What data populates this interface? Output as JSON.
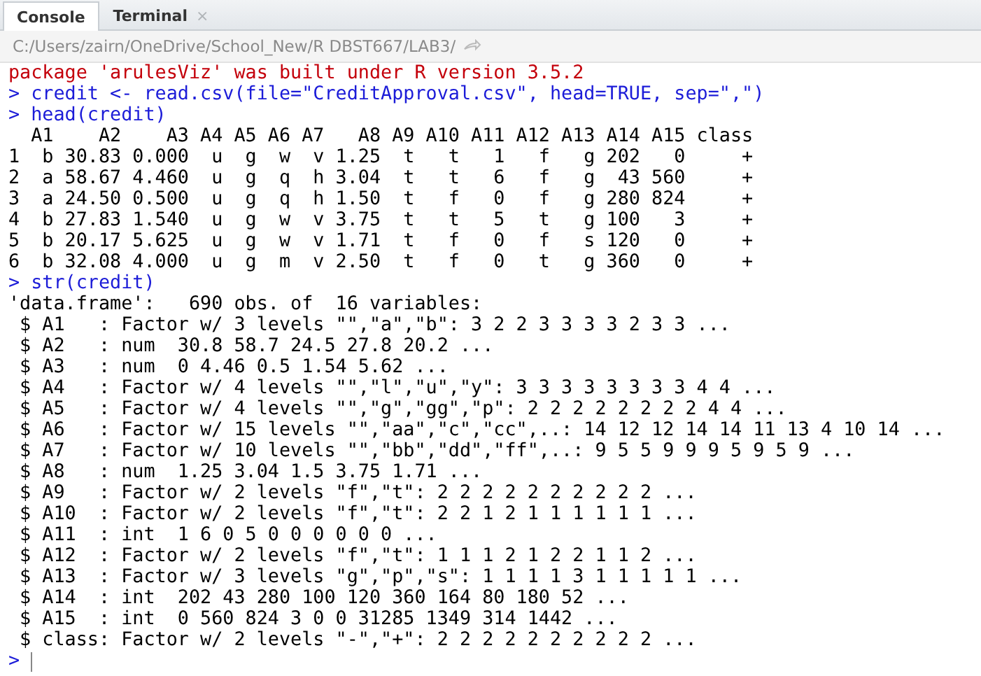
{
  "tabs": [
    {
      "label": "Console",
      "selected": true
    },
    {
      "label": "Terminal",
      "selected": false,
      "close_glyph": "×"
    }
  ],
  "path_bar": {
    "path": "C:/Users/zairn/OneDrive/School_New/R DBST667/LAB3/"
  },
  "console": {
    "lines": [
      {
        "kind": "warning",
        "text": "package 'arulesViz' was built under R version 3.5.2"
      },
      {
        "kind": "input",
        "prompt": ">",
        "text": "credit <- read.csv(file=\"CreditApproval.csv\", head=TRUE, sep=\",\")"
      },
      {
        "kind": "input",
        "prompt": ">",
        "text": "head(credit)"
      },
      {
        "kind": "output",
        "text": "  A1    A2    A3 A4 A5 A6 A7   A8 A9 A10 A11 A12 A13 A14 A15 class"
      },
      {
        "kind": "output",
        "text": "1  b 30.83 0.000  u  g  w  v 1.25  t   t   1   f   g 202   0     +"
      },
      {
        "kind": "output",
        "text": "2  a 58.67 4.460  u  g  q  h 3.04  t   t   6   f   g  43 560     +"
      },
      {
        "kind": "output",
        "text": "3  a 24.50 0.500  u  g  q  h 1.50  t   f   0   f   g 280 824     +"
      },
      {
        "kind": "output",
        "text": "4  b 27.83 1.540  u  g  w  v 3.75  t   t   5   t   g 100   3     +"
      },
      {
        "kind": "output",
        "text": "5  b 20.17 5.625  u  g  w  v 1.71  t   f   0   f   s 120   0     +"
      },
      {
        "kind": "output",
        "text": "6  b 32.08 4.000  u  g  m  v 2.50  t   f   0   t   g 360   0     +"
      },
      {
        "kind": "input",
        "prompt": ">",
        "text": "str(credit)"
      },
      {
        "kind": "output",
        "text": "'data.frame':\t690 obs. of  16 variables:"
      },
      {
        "kind": "output",
        "text": " $ A1   : Factor w/ 3 levels \"\",\"a\",\"b\": 3 2 2 3 3 3 3 2 3 3 ..."
      },
      {
        "kind": "output",
        "text": " $ A2   : num  30.8 58.7 24.5 27.8 20.2 ..."
      },
      {
        "kind": "output",
        "text": " $ A3   : num  0 4.46 0.5 1.54 5.62 ..."
      },
      {
        "kind": "output",
        "text": " $ A4   : Factor w/ 4 levels \"\",\"l\",\"u\",\"y\": 3 3 3 3 3 3 3 3 4 4 ..."
      },
      {
        "kind": "output",
        "text": " $ A5   : Factor w/ 4 levels \"\",\"g\",\"gg\",\"p\": 2 2 2 2 2 2 2 2 4 4 ..."
      },
      {
        "kind": "output",
        "text": " $ A6   : Factor w/ 15 levels \"\",\"aa\",\"c\",\"cc\",..: 14 12 12 14 14 11 13 4 10 14 ..."
      },
      {
        "kind": "output",
        "text": " $ A7   : Factor w/ 10 levels \"\",\"bb\",\"dd\",\"ff\",..: 9 5 5 9 9 9 5 9 5 9 ..."
      },
      {
        "kind": "output",
        "text": " $ A8   : num  1.25 3.04 1.5 3.75 1.71 ..."
      },
      {
        "kind": "output",
        "text": " $ A9   : Factor w/ 2 levels \"f\",\"t\": 2 2 2 2 2 2 2 2 2 2 ..."
      },
      {
        "kind": "output",
        "text": " $ A10  : Factor w/ 2 levels \"f\",\"t\": 2 2 1 2 1 1 1 1 1 1 ..."
      },
      {
        "kind": "output",
        "text": " $ A11  : int  1 6 0 5 0 0 0 0 0 0 ..."
      },
      {
        "kind": "output",
        "text": " $ A12  : Factor w/ 2 levels \"f\",\"t\": 1 1 1 2 1 2 2 1 1 2 ..."
      },
      {
        "kind": "output",
        "text": " $ A13  : Factor w/ 3 levels \"g\",\"p\",\"s\": 1 1 1 1 3 1 1 1 1 1 ..."
      },
      {
        "kind": "output",
        "text": " $ A14  : int  202 43 280 100 120 360 164 80 180 52 ..."
      },
      {
        "kind": "output",
        "text": " $ A15  : int  0 560 824 3 0 0 31285 1349 314 1442 ..."
      },
      {
        "kind": "output",
        "text": " $ class: Factor w/ 2 levels \"-\",\"+\": 2 2 2 2 2 2 2 2 2 2 ..."
      }
    ],
    "current_prompt": ">"
  }
}
